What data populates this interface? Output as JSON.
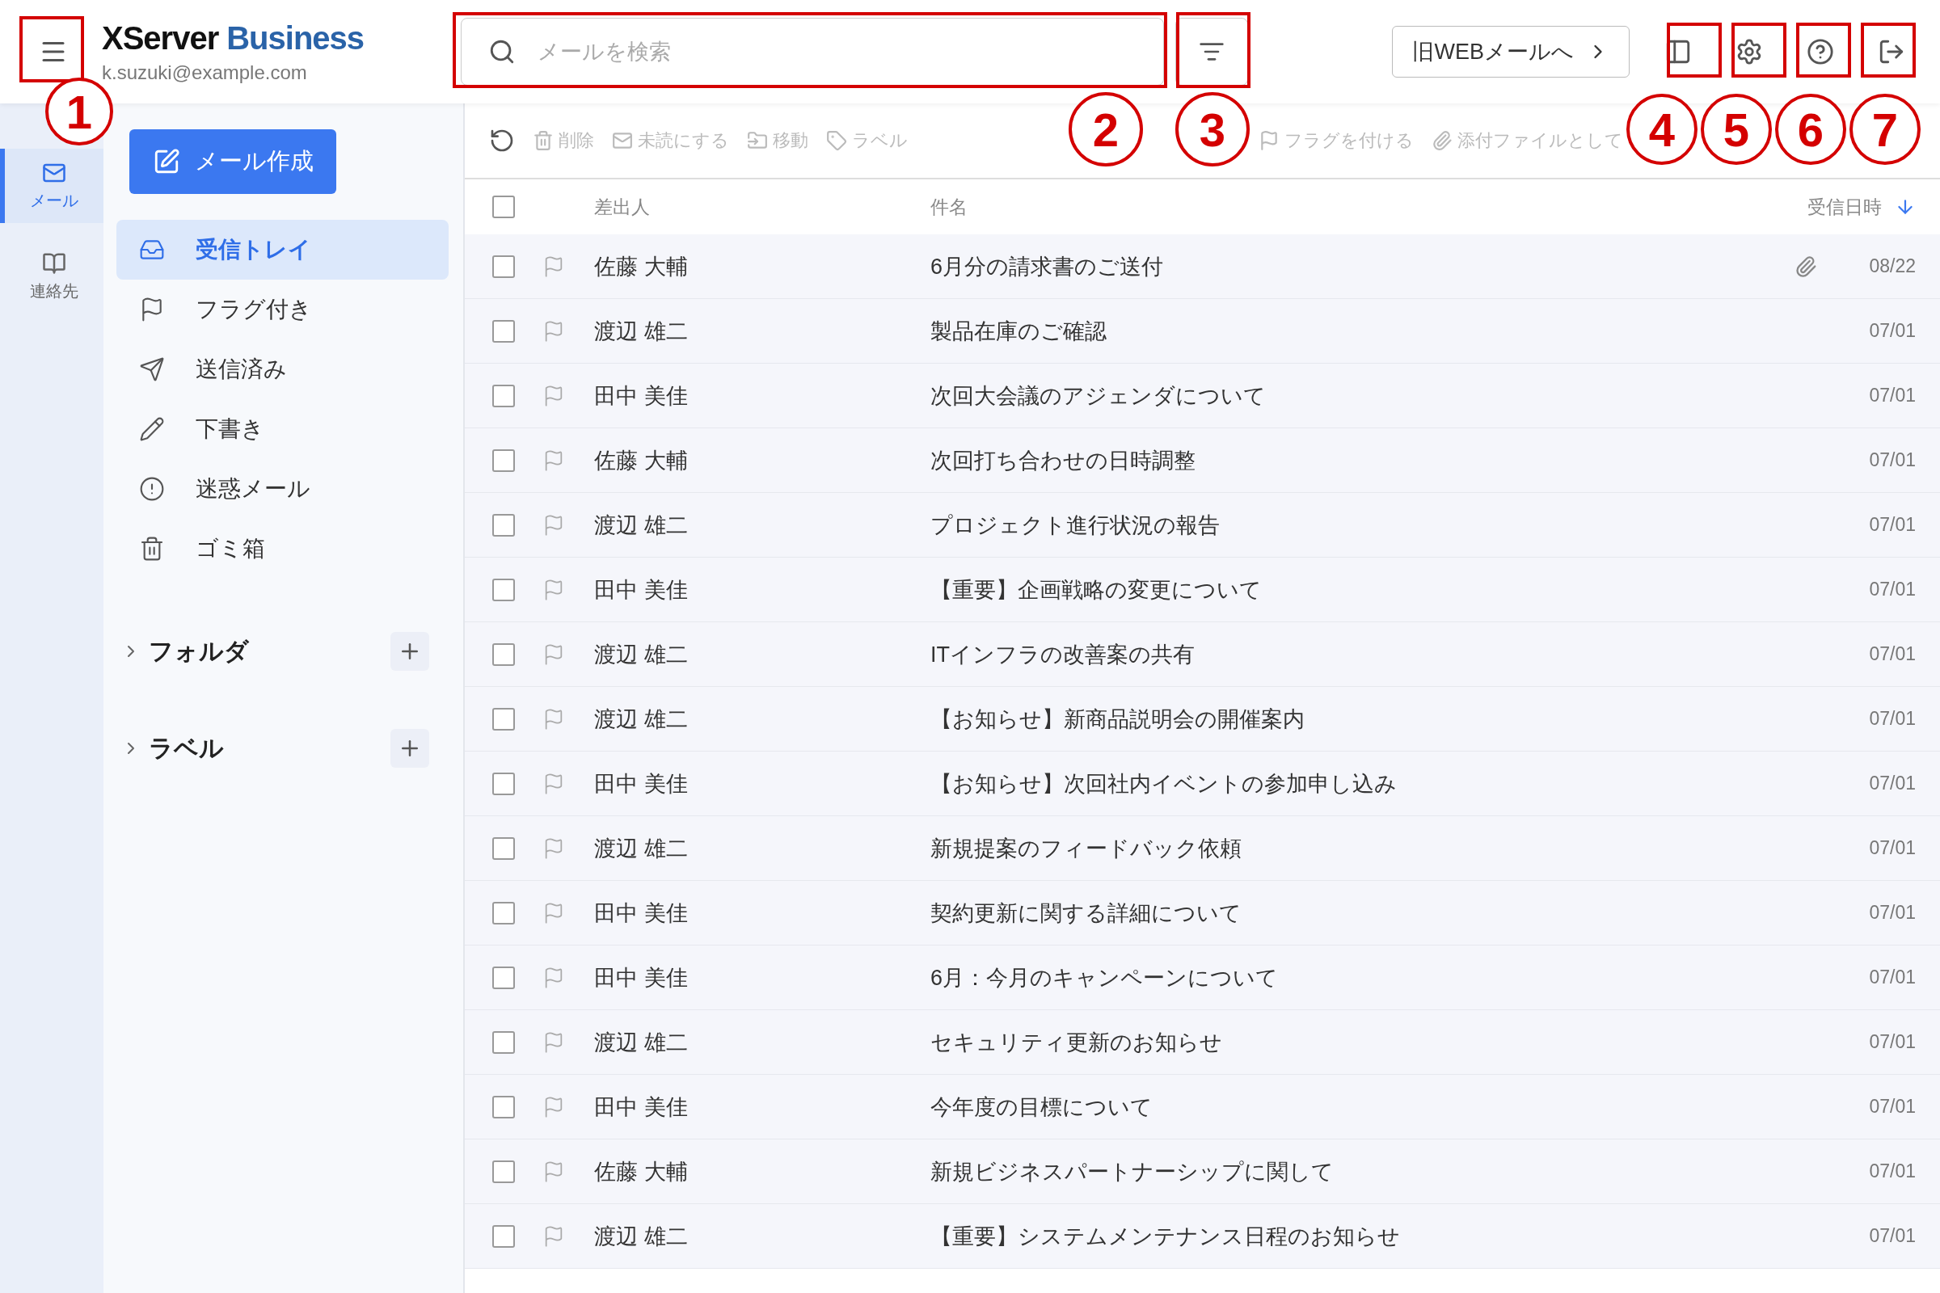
{
  "header": {
    "brand_left": "XServer",
    "brand_right": "Business",
    "account": "k.suzuki@example.com",
    "search": {
      "placeholder": "メールを検索"
    },
    "legacy_link": "旧WEBメールへ"
  },
  "rail": [
    {
      "label": "メール",
      "selected": true
    },
    {
      "label": "連絡先",
      "selected": false
    }
  ],
  "compose": "メール作成",
  "folders": [
    {
      "label": "受信トレイ",
      "selected": true
    },
    {
      "label": "フラグ付き",
      "selected": false
    },
    {
      "label": "送信済み",
      "selected": false
    },
    {
      "label": "下書き",
      "selected": false
    },
    {
      "label": "迷惑メール",
      "selected": false
    },
    {
      "label": "ゴミ箱",
      "selected": false
    }
  ],
  "sections": [
    {
      "label": "フォルダ",
      "expanded": false
    },
    {
      "label": "ラベル",
      "expanded": false
    }
  ],
  "toolbar": [
    "削除",
    "未読にする",
    "移動",
    "ラベル",
    "フラグを付ける",
    "添付ファイルとして"
  ],
  "table": {
    "columns": [
      "差出人",
      "件名",
      "受信日時"
    ],
    "select_all_checked": false,
    "rows": [
      {
        "sender": "佐藤 大輔",
        "subject": "6月分の請求書のご送付",
        "date": "08/22",
        "attachment": true,
        "checked": false,
        "flagged": false
      },
      {
        "sender": "渡辺 雄二",
        "subject": "製品在庫のご確認",
        "date": "07/01",
        "attachment": false,
        "checked": false,
        "flagged": false
      },
      {
        "sender": "田中 美佳",
        "subject": "次回大会議のアジェンダについて",
        "date": "07/01",
        "attachment": false,
        "checked": false,
        "flagged": false
      },
      {
        "sender": "佐藤 大輔",
        "subject": "次回打ち合わせの日時調整",
        "date": "07/01",
        "attachment": false,
        "checked": false,
        "flagged": false
      },
      {
        "sender": "渡辺 雄二",
        "subject": "プロジェクト進行状況の報告",
        "date": "07/01",
        "attachment": false,
        "checked": false,
        "flagged": false
      },
      {
        "sender": "田中 美佳",
        "subject": "【重要】企画戦略の変更について",
        "date": "07/01",
        "attachment": false,
        "checked": false,
        "flagged": false
      },
      {
        "sender": "渡辺 雄二",
        "subject": "ITインフラの改善案の共有",
        "date": "07/01",
        "attachment": false,
        "checked": false,
        "flagged": false
      },
      {
        "sender": "渡辺 雄二",
        "subject": "【お知らせ】新商品説明会の開催案内",
        "date": "07/01",
        "attachment": false,
        "checked": false,
        "flagged": false
      },
      {
        "sender": "田中 美佳",
        "subject": "【お知らせ】次回社内イベントの参加申し込み",
        "date": "07/01",
        "attachment": false,
        "checked": false,
        "flagged": false
      },
      {
        "sender": "渡辺 雄二",
        "subject": "新規提案のフィードバック依頼",
        "date": "07/01",
        "attachment": false,
        "checked": false,
        "flagged": false
      },
      {
        "sender": "田中 美佳",
        "subject": "契約更新に関する詳細について",
        "date": "07/01",
        "attachment": false,
        "checked": false,
        "flagged": false
      },
      {
        "sender": "田中 美佳",
        "subject": "6月：今月のキャンペーンについて",
        "date": "07/01",
        "attachment": false,
        "checked": false,
        "flagged": false
      },
      {
        "sender": "渡辺 雄二",
        "subject": "セキュリティ更新のお知らせ",
        "date": "07/01",
        "attachment": false,
        "checked": false,
        "flagged": false
      },
      {
        "sender": "田中 美佳",
        "subject": "今年度の目標について",
        "date": "07/01",
        "attachment": false,
        "checked": false,
        "flagged": false
      },
      {
        "sender": "佐藤 大輔",
        "subject": "新規ビジネスパートナーシップに関して",
        "date": "07/01",
        "attachment": false,
        "checked": false,
        "flagged": false
      },
      {
        "sender": "渡辺 雄二",
        "subject": "【重要】システムメンテナンス日程のお知らせ",
        "date": "07/01",
        "attachment": false,
        "checked": false,
        "flagged": false
      }
    ]
  },
  "callouts": [
    "1",
    "2",
    "3",
    "4",
    "5",
    "6",
    "7"
  ]
}
